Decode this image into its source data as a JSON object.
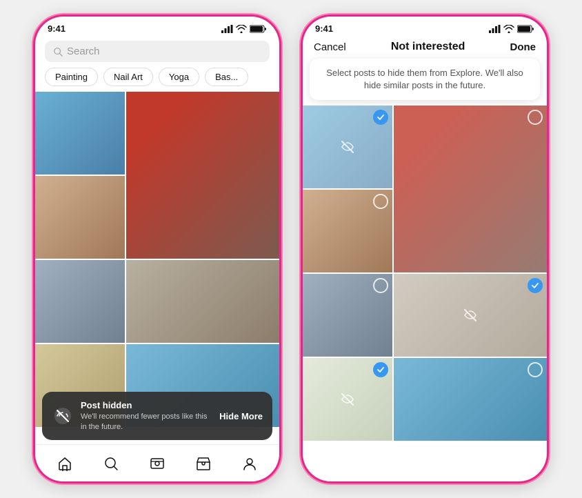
{
  "left_phone": {
    "status_time": "9:41",
    "search_placeholder": "Search",
    "categories": [
      "Painting",
      "Nail Art",
      "Yoga",
      "Bas..."
    ],
    "grid_cells": [
      {
        "id": 1,
        "color": "img-blue",
        "tall": false
      },
      {
        "id": 2,
        "color": "img-red",
        "tall": true
      },
      {
        "id": 3,
        "color": "img-people",
        "tall": false
      },
      {
        "id": 4,
        "color": "img-arch",
        "tall": false
      },
      {
        "id": 5,
        "color": "img-stone",
        "tall": false
      },
      {
        "id": 6,
        "color": "img-table",
        "tall": false
      },
      {
        "id": 7,
        "color": "img-sand",
        "tall": false
      },
      {
        "id": 8,
        "color": "img-sky",
        "tall": false
      },
      {
        "id": 9,
        "color": "img-green",
        "tall": false
      }
    ],
    "toast": {
      "title": "Post hidden",
      "subtitle": "We'll recommend fewer posts like this in the future.",
      "action": "Hide More"
    },
    "nav_icons": [
      "home",
      "search",
      "reels",
      "shop",
      "profile"
    ]
  },
  "right_phone": {
    "status_time": "9:41",
    "top_bar": {
      "cancel": "Cancel",
      "title": "Not interested",
      "done": "Done"
    },
    "tooltip": "Select posts to hide them from Explore. We'll also hide similar posts in the future.",
    "grid_cells": [
      {
        "id": 1,
        "color": "img-blue",
        "tall": false,
        "checked": true,
        "hidden": true
      },
      {
        "id": 2,
        "color": "img-red",
        "tall": true,
        "checked": false,
        "hidden": true
      },
      {
        "id": 3,
        "color": "img-people",
        "tall": false,
        "checked": false,
        "hidden": false
      },
      {
        "id": 4,
        "color": "img-arch",
        "tall": false,
        "checked": false,
        "hidden": false
      },
      {
        "id": 5,
        "color": "img-stone",
        "tall": false,
        "checked": true,
        "hidden": true
      },
      {
        "id": 6,
        "color": "img-table",
        "tall": false,
        "checked": true,
        "hidden": true
      },
      {
        "id": 7,
        "color": "img-sand",
        "tall": false,
        "checked": false,
        "hidden": false
      },
      {
        "id": 8,
        "color": "img-sky",
        "tall": false,
        "checked": false,
        "hidden": false
      },
      {
        "id": 9,
        "color": "img-green",
        "tall": false,
        "checked": false,
        "hidden": false
      },
      {
        "id": 10,
        "color": "img-food",
        "tall": false,
        "checked": false,
        "hidden": false
      },
      {
        "id": 11,
        "color": "img-gray",
        "tall": false,
        "checked": true,
        "hidden": false
      }
    ]
  }
}
